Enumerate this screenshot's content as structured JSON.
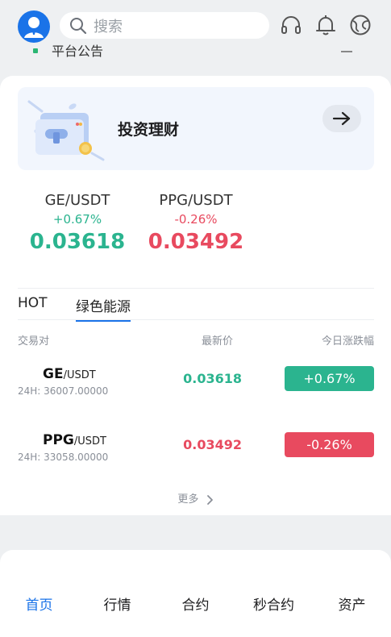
{
  "header": {
    "search_placeholder": "搜索",
    "icons": [
      "user-avatar",
      "search-icon",
      "headset-icon",
      "bell-icon",
      "globe-icon"
    ]
  },
  "notice": {
    "text": "平台公告"
  },
  "banner": {
    "title": "投资理财"
  },
  "tickers": [
    {
      "pair": "GE/USDT",
      "change": "+0.67%",
      "price": "0.03618",
      "trend": "up"
    },
    {
      "pair": "PPG/USDT",
      "change": "-0.26%",
      "price": "0.03492",
      "trend": "down"
    }
  ],
  "tabs": [
    {
      "label": "HOT",
      "active": false
    },
    {
      "label": "绿色能源",
      "active": true
    }
  ],
  "table": {
    "headers": {
      "pair": "交易对",
      "last": "最新价",
      "change": "今日涨跌幅"
    },
    "rows": [
      {
        "base": "GE",
        "quote": "/USDT",
        "volume": "24H: 36007.00000",
        "last": "0.03618",
        "change": "+0.67%",
        "trend": "up"
      },
      {
        "base": "PPG",
        "quote": "/USDT",
        "volume": "24H: 33058.00000",
        "last": "0.03492",
        "change": "-0.26%",
        "trend": "down"
      }
    ]
  },
  "more_label": "更多",
  "bottom_nav": [
    {
      "label": "首页",
      "active": true
    },
    {
      "label": "行情",
      "active": false
    },
    {
      "label": "合约",
      "active": false
    },
    {
      "label": "秒合约",
      "active": false
    },
    {
      "label": "资产",
      "active": false
    }
  ],
  "colors": {
    "up": "#2bb48f",
    "down": "#e84a5f",
    "accent": "#1a73e8"
  }
}
